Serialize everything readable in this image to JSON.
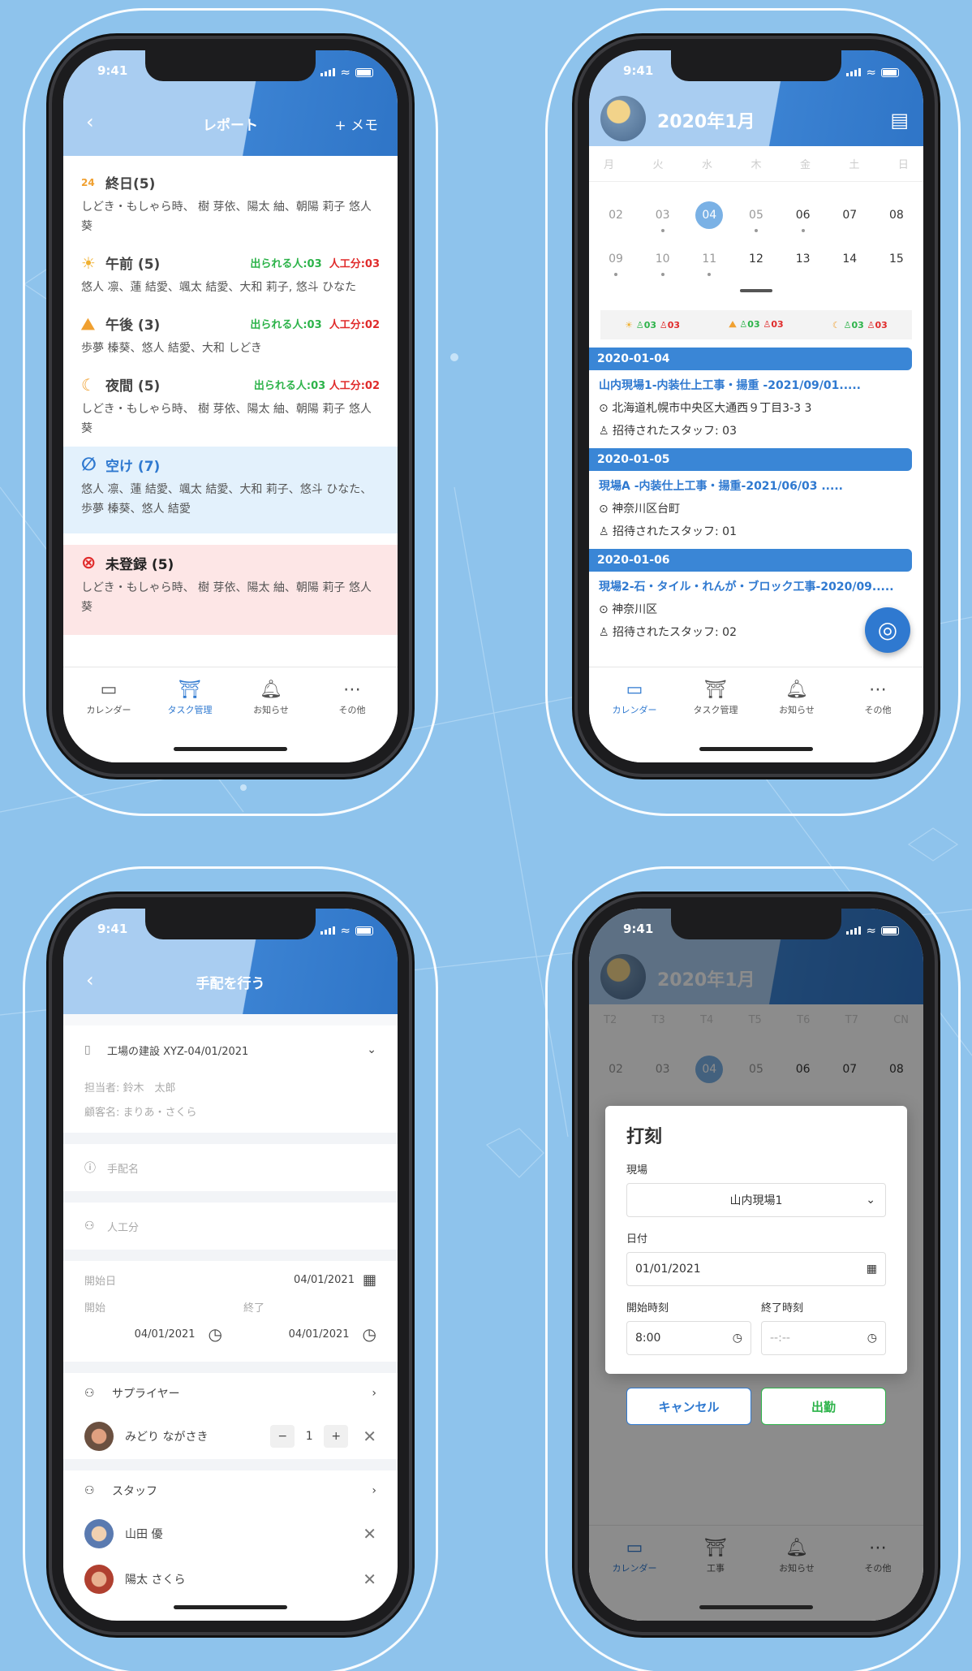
{
  "status": {
    "time": "9:41"
  },
  "tabs": {
    "calendar": "カレンダー",
    "task": "タスク管理",
    "news": "お知らせ",
    "other": "その他",
    "work": "工事"
  },
  "screen1": {
    "title": "レポート",
    "memo": "+ メモ",
    "allday": {
      "label": "終日(5)",
      "names": "しどき・もしゃら時、 樹 芽依、陽太 紬、朝陽 莉子 悠人 葵"
    },
    "am": {
      "label": "午前 (5)",
      "avail": "出られる人:03",
      "work": "人工分:03",
      "names": "悠人 凛、蓮 結愛、颯太 結愛、大和 莉子, 悠斗 ひなた"
    },
    "pm": {
      "label": "午後 (3)",
      "avail": "出られる人:03",
      "work": "人工分:02",
      "names": "歩夢 榛葵、悠人 結愛、大和 しどき"
    },
    "night": {
      "label": "夜間 (5)",
      "avail": "出られる人:03",
      "work": "人工分:02",
      "names": "しどき・もしゃら時、 樹 芽依、陽太 紬、朝陽 莉子 悠人 葵"
    },
    "empty": {
      "label": "空け (7)",
      "names": "悠人 凛、蓮 結愛、颯太 結愛、大和 莉子、悠斗 ひなた、歩夢 榛葵、悠人 結愛"
    },
    "unreg": {
      "label": "未登録 (5)",
      "names": "しどき・もしゃら時、 樹 芽依、陽太 紬、朝陽 莉子 悠人 葵"
    }
  },
  "screen2": {
    "title": "2020年1月",
    "weekdays": [
      "月",
      "火",
      "水",
      "木",
      "金",
      "土",
      "日"
    ],
    "row1": [
      "02",
      "03",
      "04",
      "05",
      "06",
      "07",
      "08"
    ],
    "row2": [
      "09",
      "10",
      "11",
      "12",
      "13",
      "14",
      "15"
    ],
    "summary": [
      "03",
      "03",
      "03",
      "03",
      "03",
      "03"
    ],
    "jobs": [
      {
        "date": "2020-01-04",
        "title": "山内現場1-内装仕上工事・揚重 -2021/09/01.....",
        "addr": "北海道札幌市中央区大通西９丁目3-3 3",
        "staff": "招待されたスタッフ: 03"
      },
      {
        "date": "2020-01-05",
        "title": "現場A -内装仕上工事・揚重-2021/06/03 .....",
        "addr": "神奈川区台町",
        "staff": "招待されたスタッフ: 01"
      },
      {
        "date": "2020-01-06",
        "title": "現場2-石・タイル・れんが・ブロック工事-2020/09.....",
        "addr": "神奈川区",
        "staff": "招待されたスタッフ: 02"
      }
    ]
  },
  "screen3": {
    "title": "手配を行う",
    "project": "工場の建設 XYZ-04/01/2021",
    "manager": "担当者:  鈴木　太郎",
    "client": "顧客名:  まりあ・さくら",
    "arrange_name": "手配名",
    "workers": "人工分",
    "start_day_label": "開始日",
    "start_day": "04/01/2021",
    "start_label": "開始",
    "end_label": "終了",
    "start": "04/01/2021",
    "end": "04/01/2021",
    "supplier": "サプライヤー",
    "supplier_person": "みどり ながさき",
    "qty": "1",
    "staff": "スタッフ",
    "staff1": "山田 優",
    "staff2": "陽太 さくら"
  },
  "screen4": {
    "title": "2020年1月",
    "weekdays": [
      "T2",
      "T3",
      "T4",
      "T5",
      "T6",
      "T7",
      "CN"
    ],
    "row1": [
      "02",
      "03",
      "04",
      "05",
      "06",
      "07",
      "08"
    ],
    "modal_title": "打刻",
    "site_label": "現場",
    "site": "山内現場1",
    "date_label": "日付",
    "date": "01/01/2021",
    "start_label": "開始時刻",
    "end_label": "終了時刻",
    "start": "8:00",
    "end": "--:--",
    "cancel": "キャンセル",
    "ok": "出勤"
  }
}
